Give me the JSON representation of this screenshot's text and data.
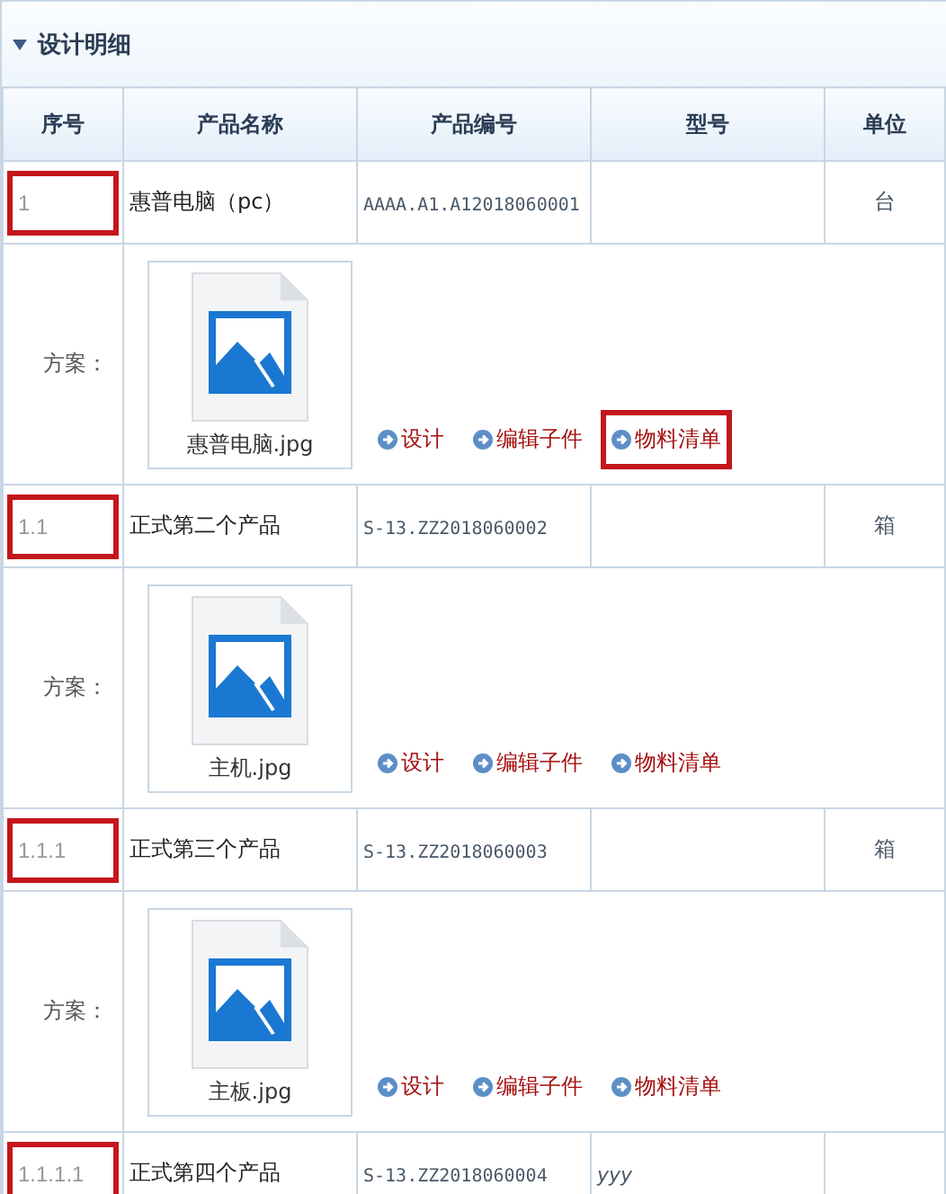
{
  "section": {
    "title": "设计明细",
    "expanded": true
  },
  "columns": [
    "序号",
    "产品名称",
    "产品编号",
    "型号",
    "单位"
  ],
  "rows": [
    {
      "seq": "1",
      "seq_highlighted": true,
      "name": "惠普电脑（pc）",
      "code": "AAAA.A1.A12018060001",
      "unit": "台",
      "plan": {
        "label": "方案：",
        "file": "惠普电脑.jpg",
        "links": [
          {
            "text": "设计",
            "highlighted": false
          },
          {
            "text": "编辑子件",
            "highlighted": false
          },
          {
            "text": "物料清单",
            "highlighted": true
          }
        ]
      }
    },
    {
      "seq": "1.1",
      "seq_highlighted": true,
      "name": "正式第二个产品",
      "code": "S-13.ZZ2018060002",
      "unit": "箱",
      "plan": {
        "label": "方案：",
        "file": "主机.jpg",
        "links": [
          {
            "text": "设计",
            "highlighted": false
          },
          {
            "text": "编辑子件",
            "highlighted": false
          },
          {
            "text": "物料清单",
            "highlighted": false
          }
        ]
      }
    },
    {
      "seq": "1.1.1",
      "seq_highlighted": true,
      "name": "正式第三个产品",
      "code": "S-13.ZZ2018060003",
      "unit": "箱",
      "plan": {
        "label": "方案：",
        "file": "主板.jpg",
        "links": [
          {
            "text": "设计",
            "highlighted": false
          },
          {
            "text": "编辑子件",
            "highlighted": false
          },
          {
            "text": "物料清单",
            "highlighted": false
          }
        ]
      }
    },
    {
      "seq": "1.1.1.1",
      "seq_highlighted": true,
      "name": "正式第四个产品",
      "code": "S-13.ZZ2018060004",
      "model": "yyy"
    }
  ]
}
